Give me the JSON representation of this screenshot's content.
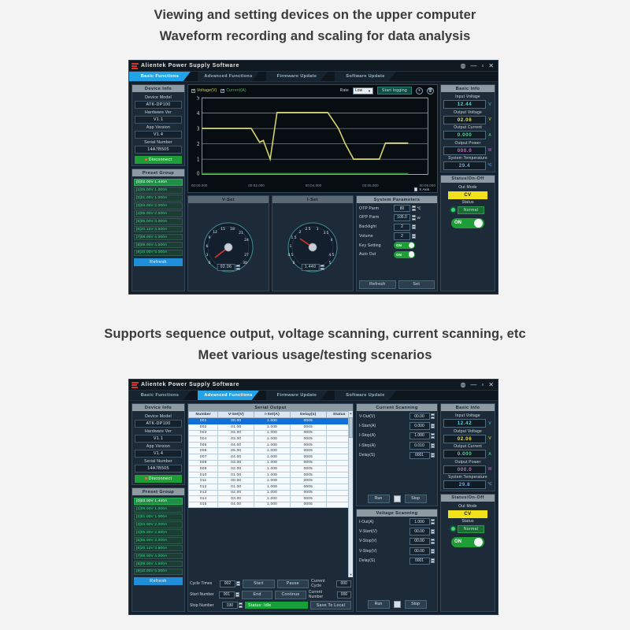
{
  "captions": {
    "top_line1": "Viewing and setting devices on the upper computer",
    "top_line2": "Waveform recording and scaling for data analysis",
    "mid_line1": "Supports sequence output, voltage scanning, current scanning, etc",
    "mid_line2": "Meet various usage/testing scenarios"
  },
  "window": {
    "title": "Alientek Power Supply Software",
    "buttons": {
      "help": "◍",
      "minimize": "—",
      "maximize": "▫",
      "close": "✕"
    },
    "tabs": [
      {
        "label": "Basic Functions"
      },
      {
        "label": "Advanced Functions"
      },
      {
        "label": "Firmware Update"
      },
      {
        "label": "Software Update"
      }
    ]
  },
  "device_info": {
    "title": "Device Info",
    "fields": [
      {
        "label": "Device Model",
        "value": "ATK-DP100"
      },
      {
        "label": "Hardware Ver",
        "value": "V1.1"
      },
      {
        "label": "App Version",
        "value": "V1.4"
      },
      {
        "label": "Serial Number",
        "value": "14A7B505"
      }
    ],
    "disconnect_label": "Disconnect"
  },
  "preset_group": {
    "title": "Preset Group",
    "items": [
      "[0]03.00V 1.440A",
      "[1]09.00V 1.000A",
      "[2]01.00V 1.000A",
      "[3]04.00V 2.000A",
      "[4]05.00V 2.500A",
      "[5]06.00V 3.000A",
      "[6]20.12V 3.500A",
      "[7]08.00V 4.000A",
      "[8]09.00V 4.500A",
      "[9]10.00V 5.000A"
    ],
    "selected_index": 0,
    "refresh_label": "Refresh"
  },
  "chart_toolbar": {
    "voltage_label": "Voltage(V)",
    "current_label": "Current(A)",
    "voltage_checked": true,
    "current_checked": true,
    "rate_label": "Rate",
    "rate_value": "Low",
    "start_logging_label": "Start logging",
    "pause_icon": "⏸",
    "trash_icon": "🗑",
    "x_axis_label": "X Axis"
  },
  "chart_data": {
    "type": "line",
    "title": "Waveform recording",
    "xlabel": "",
    "ylabel": "",
    "ylim": [
      0,
      5
    ],
    "yticks": [
      0,
      1,
      2,
      3,
      4,
      5
    ],
    "xlim": [
      0,
      8
    ],
    "xtick_labels": [
      "00:00.000",
      "00:02.000",
      "00:04.000",
      "00:06.000",
      "00:08.000"
    ],
    "xticks": [
      0,
      2,
      4,
      6,
      8
    ],
    "grid": true,
    "legend": [
      "Voltage(V)",
      "Current(A)"
    ],
    "series": [
      {
        "name": "Voltage(V)",
        "color": "#d8d66a",
        "x": [
          0.0,
          1.75,
          2.05,
          2.2,
          2.45,
          2.75,
          3.0,
          4.5,
          4.85,
          5.1,
          5.4,
          6.3,
          6.55,
          7.3
        ],
        "y": [
          3.0,
          3.0,
          2.1,
          2.2,
          1.0,
          4.05,
          4.05,
          4.05,
          3.0,
          2.0,
          1.0,
          1.0,
          2.05,
          2.05
        ]
      },
      {
        "name": "Current(A)",
        "color": "#2a8a2a",
        "x": [
          0.0,
          7.3
        ],
        "y": [
          0.0,
          0.0
        ]
      }
    ]
  },
  "v_set": {
    "title": "V-Set",
    "value": "02.06",
    "min": 0,
    "max": 30,
    "ticks": [
      "0",
      "3",
      "6",
      "9",
      "12",
      "15",
      "18",
      "21",
      "24",
      "27",
      "30"
    ],
    "needle_value": 2.06
  },
  "i_set": {
    "title": "I-Set",
    "value": "1.440",
    "min": 0,
    "max": 5,
    "ticks": [
      "0",
      "0.5",
      "1",
      "1.5",
      "2",
      "2.5",
      "3",
      "3.5",
      "4",
      "4.5",
      "5"
    ],
    "needle_value": 1.44
  },
  "system_parameters": {
    "title": "System Parameters",
    "rows": [
      {
        "label": "OTP Parm",
        "value": "80",
        "unit": "℃",
        "type": "spin"
      },
      {
        "label": "OPP Parm",
        "value": "105.0",
        "unit": "W",
        "type": "spin"
      },
      {
        "label": "Backlight",
        "value": "2",
        "unit": "",
        "type": "spin"
      },
      {
        "label": "Volume",
        "value": "2",
        "unit": "",
        "type": "spin"
      },
      {
        "label": "Key Setting",
        "value": "ON",
        "unit": "",
        "type": "toggle"
      },
      {
        "label": "Auto Out",
        "value": "ON",
        "unit": "",
        "type": "toggle"
      }
    ],
    "refresh_label": "Refresh",
    "set_label": "Set"
  },
  "basic_info_1": {
    "title": "Basic Info",
    "items": [
      {
        "label": "Input Voltage",
        "value": "12.44",
        "unit": "V",
        "color": "#3fd9e8"
      },
      {
        "label": "Output Voltage",
        "value": "02.06",
        "unit": "V",
        "color": "#f2e21c"
      },
      {
        "label": "Output Current",
        "value": "0.000",
        "unit": "A",
        "color": "#3fe08a"
      },
      {
        "label": "Output Power",
        "value": "000.0",
        "unit": "W",
        "color": "#e35fd8"
      },
      {
        "label": "System Temperature",
        "value": "29.4",
        "unit": "℃",
        "color": "#6fa8f5"
      }
    ]
  },
  "status_1": {
    "title": "Status/On-Off",
    "out_mode_label": "Out Mode",
    "out_mode_value": "CV",
    "status_label": "Status",
    "status_value": "Normal",
    "power_toggle": "ON"
  },
  "serial_output": {
    "title": "Serial Output",
    "columns": [
      "Number",
      "V-Set(V)",
      "I-Set(A)",
      "Delay(s)",
      "Status"
    ],
    "selected_row": 0,
    "rows": [
      [
        "001",
        "00.00",
        "1.000",
        "0005",
        ""
      ],
      [
        "002",
        "01.00",
        "1.000",
        "0005",
        ""
      ],
      [
        "003",
        "02.00",
        "1.000",
        "0005",
        ""
      ],
      [
        "004",
        "03.00",
        "1.000",
        "0005",
        ""
      ],
      [
        "005",
        "04.00",
        "1.000",
        "0005",
        ""
      ],
      [
        "006",
        "05.00",
        "1.000",
        "0005",
        ""
      ],
      [
        "007",
        "04.00",
        "1.000",
        "0005",
        ""
      ],
      [
        "008",
        "03.00",
        "1.000",
        "0005",
        ""
      ],
      [
        "009",
        "02.00",
        "1.000",
        "0005",
        ""
      ],
      [
        "010",
        "01.00",
        "1.000",
        "0005",
        ""
      ],
      [
        "011",
        "00.00",
        "1.000",
        "0005",
        ""
      ],
      [
        "012",
        "01.00",
        "1.000",
        "0005",
        ""
      ],
      [
        "013",
        "02.00",
        "1.000",
        "0005",
        ""
      ],
      [
        "014",
        "03.00",
        "1.000",
        "0005",
        ""
      ],
      [
        "015",
        "04.00",
        "1.000",
        "0005",
        ""
      ]
    ]
  },
  "sequence_controls": {
    "cycle_times_label": "Cycle Times",
    "cycle_times_value": "002",
    "start_number_label": "Start Number",
    "start_number_value": "001",
    "stop_number_label": "Stop Number",
    "stop_number_value": "030",
    "start_label": "Start",
    "pause_label": "Pause",
    "end_label": "End",
    "continue_label": "Continue",
    "current_cycle_label": "Current Cycle",
    "current_cycle_value": "000",
    "current_number_label": "Current Number",
    "current_number_value": "000",
    "status_text": "Status: Idle",
    "save_label": "Save To Local"
  },
  "current_scanning": {
    "title": "Current Scanning",
    "rows": [
      {
        "label": "V-Out(V)",
        "value": "00.00"
      },
      {
        "label": "I-Start(A)",
        "value": "0.000"
      },
      {
        "label": "I-Stop(A)",
        "value": "1.000"
      },
      {
        "label": "I-Step(A)",
        "value": "0.010"
      },
      {
        "label": "Delay(S)",
        "value": "0001"
      }
    ],
    "run_label": "Run",
    "stop_label": "Stop"
  },
  "voltage_scanning": {
    "title": "Voltage Scanning",
    "rows": [
      {
        "label": "I-Out(A)",
        "value": "1.000"
      },
      {
        "label": "V-Start(V)",
        "value": "00.00"
      },
      {
        "label": "V-Stop(V)",
        "value": "00.00"
      },
      {
        "label": "V-Step(V)",
        "value": "00.00"
      },
      {
        "label": "Delay(S)",
        "value": "0001"
      }
    ],
    "run_label": "Run",
    "stop_label": "Stop"
  },
  "basic_info_2": {
    "title": "Basic Info",
    "items": [
      {
        "label": "Input Voltage",
        "value": "12.42",
        "unit": "V",
        "color": "#3fd9e8"
      },
      {
        "label": "Output Voltage",
        "value": "02.06",
        "unit": "V",
        "color": "#f2e21c"
      },
      {
        "label": "Output Current",
        "value": "0.000",
        "unit": "A",
        "color": "#3fe08a"
      },
      {
        "label": "Output Power",
        "value": "000.0",
        "unit": "W",
        "color": "#e35fd8"
      },
      {
        "label": "System Temperature",
        "value": "29.8",
        "unit": "℃",
        "color": "#6fa8f5"
      }
    ]
  },
  "status_2": {
    "title": "Status/On-Off",
    "out_mode_label": "Out Mode",
    "out_mode_value": "CV",
    "status_label": "Status",
    "status_value": "Normal",
    "power_toggle": "ON"
  }
}
